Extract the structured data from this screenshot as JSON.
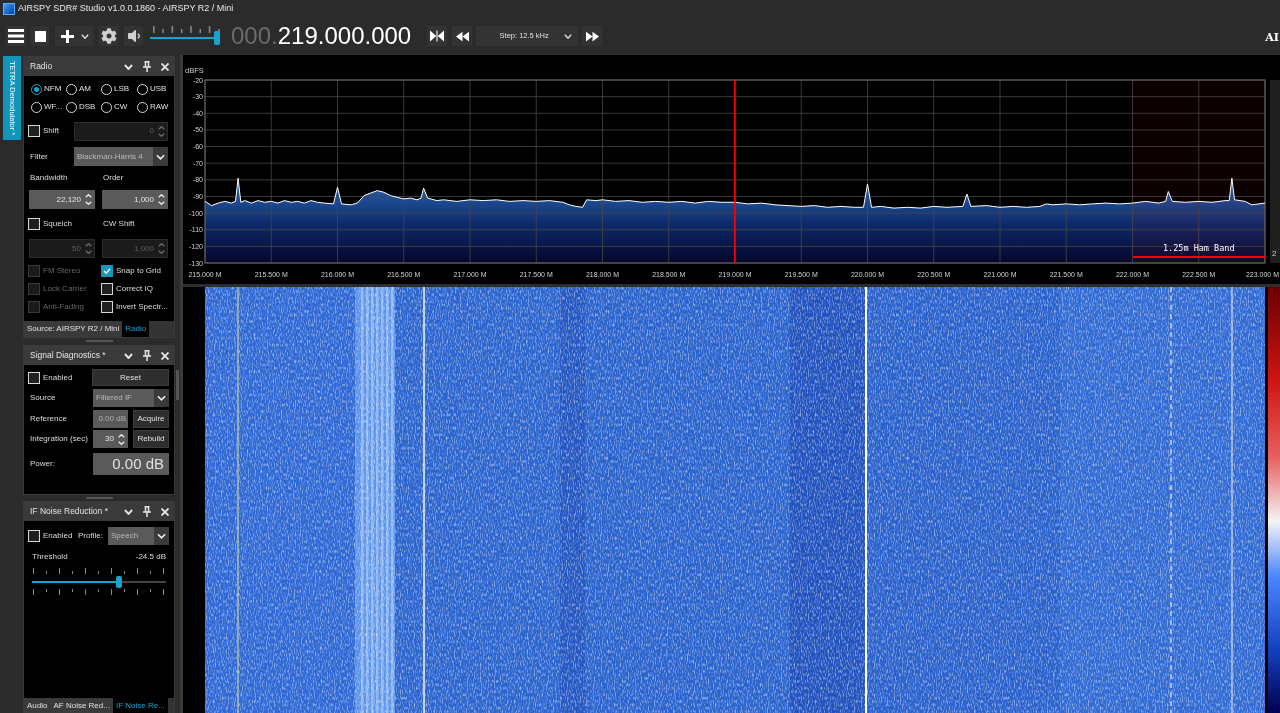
{
  "window": {
    "title": "AIRSPY SDR# Studio v1.0.0.1860 - AIRSPY R2 / Mini"
  },
  "toolbar": {
    "volume": {
      "level": 1
    },
    "frequency": {
      "leading": "000.",
      "value": "219.000.000"
    },
    "step": {
      "value": "Step: 12.5 kHz"
    },
    "logo_text": "AI"
  },
  "side_tabs": [
    {
      "label": "TETRA Demodulator *",
      "selected": true
    }
  ],
  "radio_panel": {
    "title": "Radio",
    "modes": [
      {
        "label": "NFM",
        "selected": true
      },
      {
        "label": "AM",
        "selected": false
      },
      {
        "label": "LSB",
        "selected": false
      },
      {
        "label": "USB",
        "selected": false
      },
      {
        "label": "WF...",
        "selected": false
      },
      {
        "label": "DSB",
        "selected": false
      },
      {
        "label": "CW",
        "selected": false
      },
      {
        "label": "RAW",
        "selected": false
      }
    ],
    "shift": {
      "checkbox": {
        "label": "Shift",
        "checked": false
      },
      "field": {
        "value": "0",
        "disabled": true
      }
    },
    "filter": {
      "label": "Filter",
      "value": "Blackman-Harris 4"
    },
    "bandwidth": {
      "label": "Bandwidth",
      "field": {
        "value": "22,120",
        "disabled": false
      }
    },
    "order": {
      "label": "Order",
      "field": {
        "value": "1,000",
        "disabled": false
      }
    },
    "squelch": {
      "checkbox": {
        "label": "Squelch",
        "checked": false
      },
      "field": {
        "value": "50",
        "disabled": true
      }
    },
    "cw_shift": {
      "label": "CW Shift",
      "field": {
        "value": "1,000",
        "disabled": true
      }
    },
    "options": [
      {
        "label": "FM Stereo",
        "checked": false,
        "disabled": true
      },
      {
        "label": "Snap to Grid",
        "checked": true,
        "disabled": false
      },
      {
        "label": "Lock Carrier",
        "checked": false,
        "disabled": true
      },
      {
        "label": "Correct IQ",
        "checked": false,
        "disabled": false
      },
      {
        "label": "Anti-Fading",
        "checked": false,
        "disabled": true
      },
      {
        "label": "Invert Spectr...",
        "checked": false,
        "disabled": false
      }
    ],
    "tabs": [
      {
        "label": "Source: AIRSPY R2 / Mini",
        "selected": false
      },
      {
        "label": "Radio",
        "selected": true
      }
    ]
  },
  "signal_diagnostics": {
    "title": "Signal Diagnostics *",
    "enabled": {
      "label": "Enabled",
      "checked": false
    },
    "reset_button": "Reset",
    "source": {
      "label": "Source",
      "value": "Filtered IF"
    },
    "reference": {
      "label": "Reference",
      "value": "0.00 dB",
      "button": "Acquire"
    },
    "integration": {
      "label": "Integration (sec)",
      "field": {
        "value": "30"
      },
      "button": "Rebuild"
    },
    "power": {
      "label": "Power:",
      "value": "0.00 dB"
    }
  },
  "if_noise_reduction": {
    "title": "IF Noise Reduction *",
    "enabled": {
      "label": "Enabled",
      "checked": false
    },
    "profile": {
      "label": "Profile:",
      "value": "Speech"
    },
    "threshold": {
      "label": "Threshold",
      "reading": "-24.5 dB",
      "level": 0.66
    },
    "tabs": [
      {
        "label": "Audio",
        "selected": false
      },
      {
        "label": "AF Noise Red...",
        "selected": false
      },
      {
        "label": "IF Noise Re...",
        "selected": true
      }
    ]
  },
  "spectrum": {
    "side_label": "2",
    "chart_data": [
      {
        "type": "line",
        "ylabel": "dBFS",
        "xlim": [
          215,
          223
        ],
        "ylim": [
          -130,
          -20
        ],
        "xticks": [
          {
            "value": 215,
            "label": "215.000 M"
          },
          {
            "value": 215.5,
            "label": "215.500 M"
          },
          {
            "value": 216,
            "label": "216.000 M"
          },
          {
            "value": 216.5,
            "label": "216.500 M"
          },
          {
            "value": 217,
            "label": "217.000 M"
          },
          {
            "value": 217.5,
            "label": "217.500 M"
          },
          {
            "value": 218,
            "label": "218.000 M"
          },
          {
            "value": 218.5,
            "label": "218.500 M"
          },
          {
            "value": 219,
            "label": "219.000 M"
          },
          {
            "value": 219.5,
            "label": "219.500 M"
          },
          {
            "value": 220,
            "label": "220.000 M"
          },
          {
            "value": 220.5,
            "label": "220.500 M"
          },
          {
            "value": 221,
            "label": "221.000 M"
          },
          {
            "value": 221.5,
            "label": "221.500 M"
          },
          {
            "value": 222,
            "label": "222.000 M"
          },
          {
            "value": 222.5,
            "label": "222.500 M"
          },
          {
            "value": 223,
            "label": "223.000 M"
          }
        ],
        "yticks": [
          -130,
          -120,
          -110,
          -100,
          -90,
          -80,
          -70,
          -60,
          -50,
          -40,
          -30,
          -20
        ],
        "grid": true,
        "color": "#ffffff",
        "x": [
          215.0,
          215.05,
          215.1,
          215.15,
          215.2,
          215.23,
          215.25,
          215.27,
          215.3,
          215.35,
          215.4,
          215.45,
          215.5,
          215.55,
          215.6,
          215.65,
          215.7,
          215.75,
          215.8,
          215.85,
          215.9,
          215.97,
          216.0,
          216.03,
          216.1,
          216.15,
          216.2,
          216.25,
          216.3,
          216.35,
          216.4,
          216.45,
          216.5,
          216.55,
          216.6,
          216.63,
          216.65,
          216.68,
          216.75,
          216.8,
          216.9,
          217.0,
          217.1,
          217.2,
          217.3,
          217.4,
          217.5,
          217.6,
          217.7,
          217.75,
          217.8,
          217.85,
          217.88,
          217.95,
          218.0,
          218.1,
          218.2,
          218.3,
          218.4,
          218.5,
          218.6,
          218.7,
          218.8,
          218.9,
          219.0,
          219.1,
          219.2,
          219.3,
          219.4,
          219.5,
          219.6,
          219.7,
          219.8,
          219.9,
          219.97,
          220.0,
          220.03,
          220.1,
          220.2,
          220.3,
          220.4,
          220.5,
          220.6,
          220.72,
          220.75,
          220.78,
          220.9,
          221.0,
          221.1,
          221.2,
          221.3,
          221.35,
          221.4,
          221.5,
          221.6,
          221.7,
          221.8,
          221.9,
          222.0,
          222.1,
          222.2,
          222.25,
          222.27,
          222.3,
          222.4,
          222.5,
          222.6,
          222.7,
          222.73,
          222.75,
          222.77,
          222.85,
          222.9,
          223.0
        ],
        "values": [
          -93,
          -95.5,
          -94,
          -93,
          -94,
          -93,
          -79,
          -93.5,
          -92.5,
          -94,
          -92.5,
          -93.5,
          -93,
          -94,
          -92.5,
          -93.5,
          -93,
          -94,
          -92.5,
          -93.5,
          -94,
          -94.5,
          -84.5,
          -94.5,
          -95,
          -94,
          -89.5,
          -88,
          -86.5,
          -87.5,
          -89.5,
          -90.5,
          -91.5,
          -91,
          -92,
          -91,
          -85,
          -91,
          -92.5,
          -92,
          -93,
          -92,
          -92.5,
          -92,
          -93,
          -92.5,
          -93,
          -92.5,
          -93.5,
          -95,
          -96,
          -96.5,
          -92,
          -92.5,
          -92,
          -93,
          -92.5,
          -93.5,
          -93,
          -93.5,
          -93,
          -94,
          -93,
          -93.5,
          -93.5,
          -94.5,
          -94,
          -95,
          -95.5,
          -96,
          -95.5,
          -96.5,
          -96,
          -96.5,
          -96.5,
          -82.5,
          -96.5,
          -96,
          -97,
          -96.5,
          -97,
          -96,
          -96.5,
          -96,
          -88.5,
          -96,
          -95.5,
          -96.5,
          -96,
          -96.5,
          -96,
          -94.5,
          -95,
          -94.5,
          -95,
          -94.5,
          -94,
          -94.5,
          -94,
          -93,
          -94,
          -93,
          -87,
          -93,
          -93.5,
          -93,
          -93.5,
          -92.5,
          -92.5,
          -79,
          -92,
          -93,
          -95,
          -94
        ],
        "ref_lines": [
          {
            "axis": "x",
            "value": 219,
            "color": "#ff0000"
          }
        ],
        "bands": [
          {
            "axis": "x",
            "from": 222,
            "to": 223,
            "label": "1.25m Ham Band",
            "color": "#ff0000"
          }
        ]
      }
    ]
  }
}
